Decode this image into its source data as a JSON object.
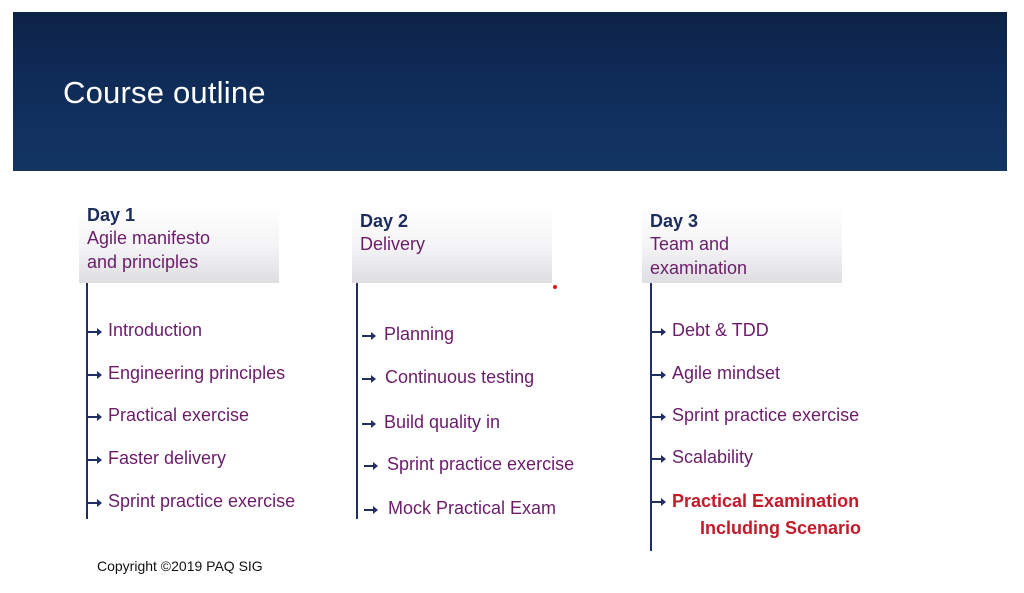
{
  "slide": {
    "title": "Course outline",
    "copyright": "Copyright ©2019 PAQ SIG"
  },
  "days": [
    {
      "day": "Day 1",
      "topic": "Agile manifesto\nand principles",
      "items": [
        "Introduction",
        "Engineering principles",
        "Practical exercise",
        "Faster delivery",
        "Sprint practice exercise"
      ]
    },
    {
      "day": "Day 2",
      "topic": "Delivery",
      "items": [
        "Planning",
        "Continuous testing",
        "Build quality in",
        "Sprint practice exercise",
        "Mock Practical Exam"
      ]
    },
    {
      "day": "Day 3",
      "topic": "Team and\nexamination",
      "items": [
        "Debt & TDD",
        "Agile mindset",
        "Sprint practice exercise",
        "Scalability"
      ],
      "exam_line1": "Practical Examination",
      "exam_line2": "Including Scenario"
    }
  ],
  "colors": {
    "banner": "#0f2b57",
    "day_label": "#1c2d5c",
    "item_text": "#6b1c6b",
    "exam_text": "#c41a2a",
    "line": "#1f2f66"
  },
  "icons": {
    "bullet": "arrow-right-icon"
  }
}
